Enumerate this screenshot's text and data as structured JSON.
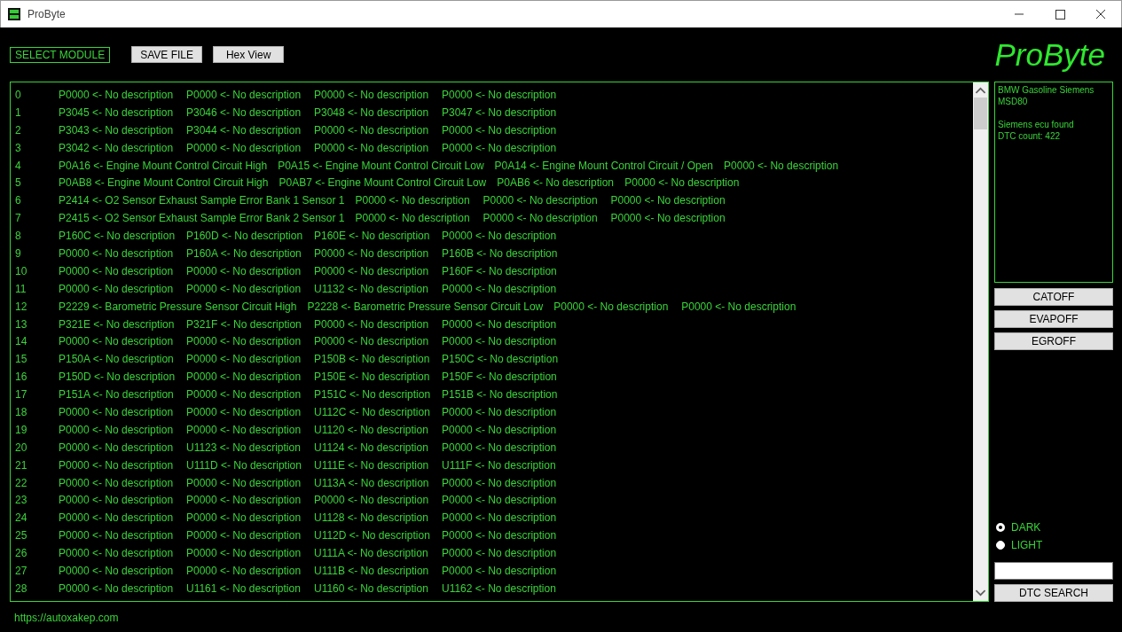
{
  "window": {
    "title": "ProByte"
  },
  "toolbar": {
    "module_button": "SELECT MODULE",
    "buttons": [
      "SAVE FILE",
      "Hex View"
    ],
    "logo": "ProByte"
  },
  "dtc_rows": [
    {
      "index": "0",
      "entries": [
        "P0000 <- No description",
        "P0000 <- No description",
        "P0000 <- No description",
        "P0000 <- No description"
      ]
    },
    {
      "index": "1",
      "entries": [
        "P3045 <- No description",
        "P3046 <- No description",
        "P3048 <- No description",
        "P3047 <- No description"
      ]
    },
    {
      "index": "2",
      "entries": [
        "P3043 <- No description",
        "P3044 <- No description",
        "P0000 <- No description",
        "P0000 <- No description"
      ]
    },
    {
      "index": "3",
      "entries": [
        "P3042 <- No description",
        "P0000 <- No description",
        "P0000 <- No description",
        "P0000 <- No description"
      ]
    },
    {
      "index": "4",
      "entries": [
        "P0A16 <- Engine Mount Control Circuit High",
        "P0A15 <- Engine Mount Control Circuit Low",
        "P0A14 <- Engine Mount Control Circuit / Open",
        "P0000 <- No description"
      ]
    },
    {
      "index": "5",
      "entries": [
        "P0AB8 <- Engine Mount Control Circuit High",
        "P0AB7 <- Engine Mount Control Circuit Low",
        "P0AB6 <- No description",
        "P0000 <- No description"
      ]
    },
    {
      "index": "6",
      "entries": [
        "P2414 <- O2 Sensor Exhaust Sample Error Bank 1 Sensor 1",
        "P0000 <- No description",
        "P0000 <- No description",
        "P0000 <- No description"
      ]
    },
    {
      "index": "7",
      "entries": [
        "P2415 <- O2 Sensor Exhaust Sample Error Bank 2 Sensor 1",
        "P0000 <- No description",
        "P0000 <- No description",
        "P0000 <- No description"
      ]
    },
    {
      "index": "8",
      "entries": [
        "P160C <- No description",
        "P160D <- No description",
        "P160E <- No description",
        "P0000 <- No description"
      ]
    },
    {
      "index": "9",
      "entries": [
        "P0000 <- No description",
        "P160A <- No description",
        "P0000 <- No description",
        "P160B <- No description"
      ]
    },
    {
      "index": "10",
      "entries": [
        "P0000 <- No description",
        "P0000 <- No description",
        "P0000 <- No description",
        "P160F <- No description"
      ]
    },
    {
      "index": "11",
      "entries": [
        "P0000 <- No description",
        "P0000 <- No description",
        "U1132 <- No description",
        "P0000 <- No description"
      ]
    },
    {
      "index": "12",
      "entries": [
        "P2229 <- Barometric Pressure Sensor Circuit High",
        "P2228 <- Barometric Pressure Sensor Circuit Low",
        "P0000 <- No description",
        "P0000 <- No description"
      ]
    },
    {
      "index": "13",
      "entries": [
        "P321E <- No description",
        "P321F <- No description",
        "P0000 <- No description",
        "P0000 <- No description"
      ]
    },
    {
      "index": "14",
      "entries": [
        "P0000 <- No description",
        "P0000 <- No description",
        "P0000 <- No description",
        "P0000 <- No description"
      ]
    },
    {
      "index": "15",
      "entries": [
        "P150A <- No description",
        "P0000 <- No description",
        "P150B <- No description",
        "P150C <- No description"
      ]
    },
    {
      "index": "16",
      "entries": [
        "P150D <- No description",
        "P0000 <- No description",
        "P150E <- No description",
        "P150F <- No description"
      ]
    },
    {
      "index": "17",
      "entries": [
        "P151A <- No description",
        "P0000 <- No description",
        "P151C <- No description",
        "P151B <- No description"
      ]
    },
    {
      "index": "18",
      "entries": [
        "P0000 <- No description",
        "P0000 <- No description",
        "U112C <- No description",
        "P0000 <- No description"
      ]
    },
    {
      "index": "19",
      "entries": [
        "P0000 <- No description",
        "P0000 <- No description",
        "U1120 <- No description",
        "P0000 <- No description"
      ]
    },
    {
      "index": "20",
      "entries": [
        "P0000 <- No description",
        "U1123 <- No description",
        "U1124 <- No description",
        "P0000 <- No description"
      ]
    },
    {
      "index": "21",
      "entries": [
        "P0000 <- No description",
        "U111D <- No description",
        "U111E <- No description",
        "U111F <- No description"
      ]
    },
    {
      "index": "22",
      "entries": [
        "P0000 <- No description",
        "P0000 <- No description",
        "U113A <- No description",
        "P0000 <- No description"
      ]
    },
    {
      "index": "23",
      "entries": [
        "P0000 <- No description",
        "P0000 <- No description",
        "P0000 <- No description",
        "P0000 <- No description"
      ]
    },
    {
      "index": "24",
      "entries": [
        "P0000 <- No description",
        "P0000 <- No description",
        "U1128 <- No description",
        "P0000 <- No description"
      ]
    },
    {
      "index": "25",
      "entries": [
        "P0000 <- No description",
        "P0000 <- No description",
        "U112D <- No description",
        "P0000 <- No description"
      ]
    },
    {
      "index": "26",
      "entries": [
        "P0000 <- No description",
        "P0000 <- No description",
        "U111A <- No description",
        "P0000 <- No description"
      ]
    },
    {
      "index": "27",
      "entries": [
        "P0000 <- No description",
        "P0000 <- No description",
        "U111B <- No description",
        "P0000 <- No description"
      ]
    },
    {
      "index": "28",
      "entries": [
        "P0000 <- No description",
        "U1161 <- No description",
        "U1160 <- No description",
        "U1162 <- No description"
      ]
    }
  ],
  "info_panel": {
    "blocks": [
      [
        "BMW Gasoline Siemens",
        "MSD80"
      ],
      [
        "Siemens ecu found",
        "DTC count: 422"
      ]
    ]
  },
  "actions": [
    "CATOFF",
    "EVAPOFF",
    "EGROFF"
  ],
  "theme_options": [
    {
      "label": "DARK",
      "selected": true
    },
    {
      "label": "LIGHT",
      "selected": false
    }
  ],
  "search": {
    "button": "DTC SEARCH"
  },
  "footer_link": "https://autoxakep.com"
}
